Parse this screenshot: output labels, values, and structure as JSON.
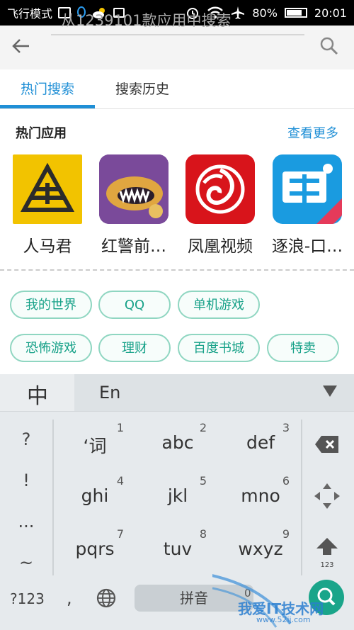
{
  "status_bar": {
    "mode_text": "飞行模式",
    "battery": "80%",
    "battery_level": 0.8,
    "time": "20:01",
    "icons": [
      "gallery-icon",
      "qq-icon",
      "weather-icon",
      "sim-icon",
      "alarm-icon",
      "wifi-icon",
      "airplane-icon",
      "battery-icon"
    ]
  },
  "search": {
    "placeholder": "从1239101款应用中搜索",
    "back_icon": "back-arrow-icon",
    "search_icon": "search-icon"
  },
  "tabs": [
    {
      "label": "热门搜索",
      "active": true
    },
    {
      "label": "搜索历史",
      "active": false
    }
  ],
  "hot_apps": {
    "title": "热门应用",
    "more": "查看更多",
    "apps": [
      {
        "name": "人马君",
        "icon": "renmajun-logo-icon",
        "color": "#f2c300"
      },
      {
        "name": "红警前…",
        "icon": "red-alert-game-icon",
        "color": "#6a3b86"
      },
      {
        "name": "凤凰视频",
        "icon": "phoenix-video-icon",
        "color": "#d8141b"
      },
      {
        "name": "逐浪-口…",
        "icon": "book-app-icon",
        "color": "#1a9be0"
      }
    ]
  },
  "hot_keywords": [
    "我的世界",
    "QQ",
    "单机游戏",
    "恐怖游戏",
    "理财",
    "百度书城",
    "特卖"
  ],
  "keyboard": {
    "mode_zh": "中",
    "mode_en": "En",
    "left_keys": [
      "?",
      "!",
      "...",
      "~"
    ],
    "keys": [
      {
        "label": "‘词",
        "num": "1"
      },
      {
        "label": "abc",
        "num": "2"
      },
      {
        "label": "def",
        "num": "3"
      },
      {
        "label": "ghi",
        "num": "4"
      },
      {
        "label": "jkl",
        "num": "5"
      },
      {
        "label": "mno",
        "num": "6"
      },
      {
        "label": "pqrs",
        "num": "7"
      },
      {
        "label": "tuv",
        "num": "8"
      },
      {
        "label": "wxyz",
        "num": "9"
      }
    ],
    "shift_sub": "123",
    "bottom": {
      "sym": "?123",
      "comma": ",",
      "space": "拼音",
      "zero": "0"
    }
  },
  "watermark": {
    "text": "我爱IT技术网",
    "url": "www.52ij.com"
  }
}
